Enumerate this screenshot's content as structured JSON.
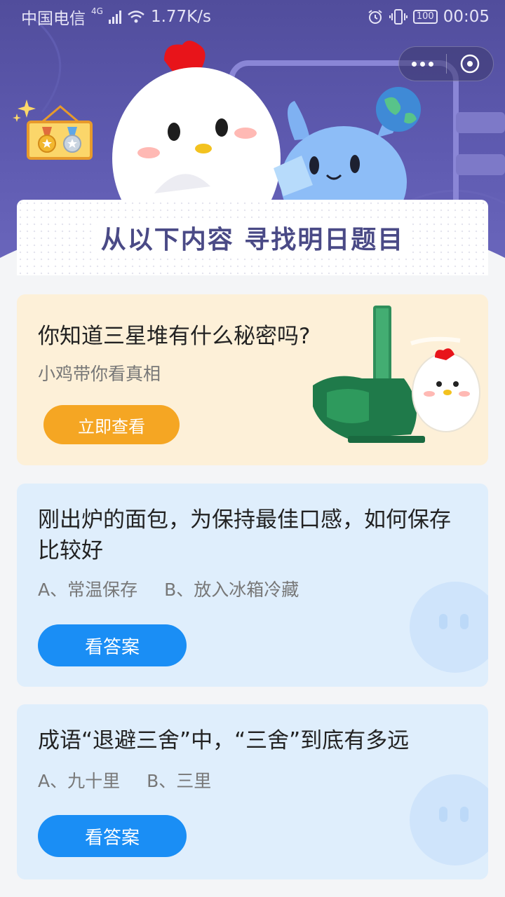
{
  "status_bar": {
    "carrier": "中国电信",
    "network": "4G",
    "speed": "1.77K/s",
    "battery": "100",
    "time": "00:05"
  },
  "mini_program_capsule": {
    "more_icon": "more-dots-icon",
    "close_icon": "close-circle-icon"
  },
  "hero": {
    "banner_title": "从以下内容  寻找明日题目",
    "colors": {
      "background": "#5a56a8",
      "banner_text": "#4a4a86"
    }
  },
  "promo_card": {
    "title": "你知道三星堆有什么秘密吗?",
    "subtitle": "小鸡带你看真相",
    "button_label": "立即查看",
    "colors": {
      "background": "#fdf0d8",
      "button": "#f5a623"
    }
  },
  "questions": [
    {
      "title": "刚出炉的面包，为保持最佳口感，如何保存比较好",
      "options": [
        "A、常温保存",
        "B、放入冰箱冷藏"
      ],
      "button_label": "看答案"
    },
    {
      "title": "成语“退避三舍”中，“三舍”到底有多远",
      "options": [
        "A、九十里",
        "B、三里"
      ],
      "button_label": "看答案"
    }
  ],
  "colors": {
    "question_card": "#dfeefc",
    "answer_button": "#1a8ef5"
  }
}
